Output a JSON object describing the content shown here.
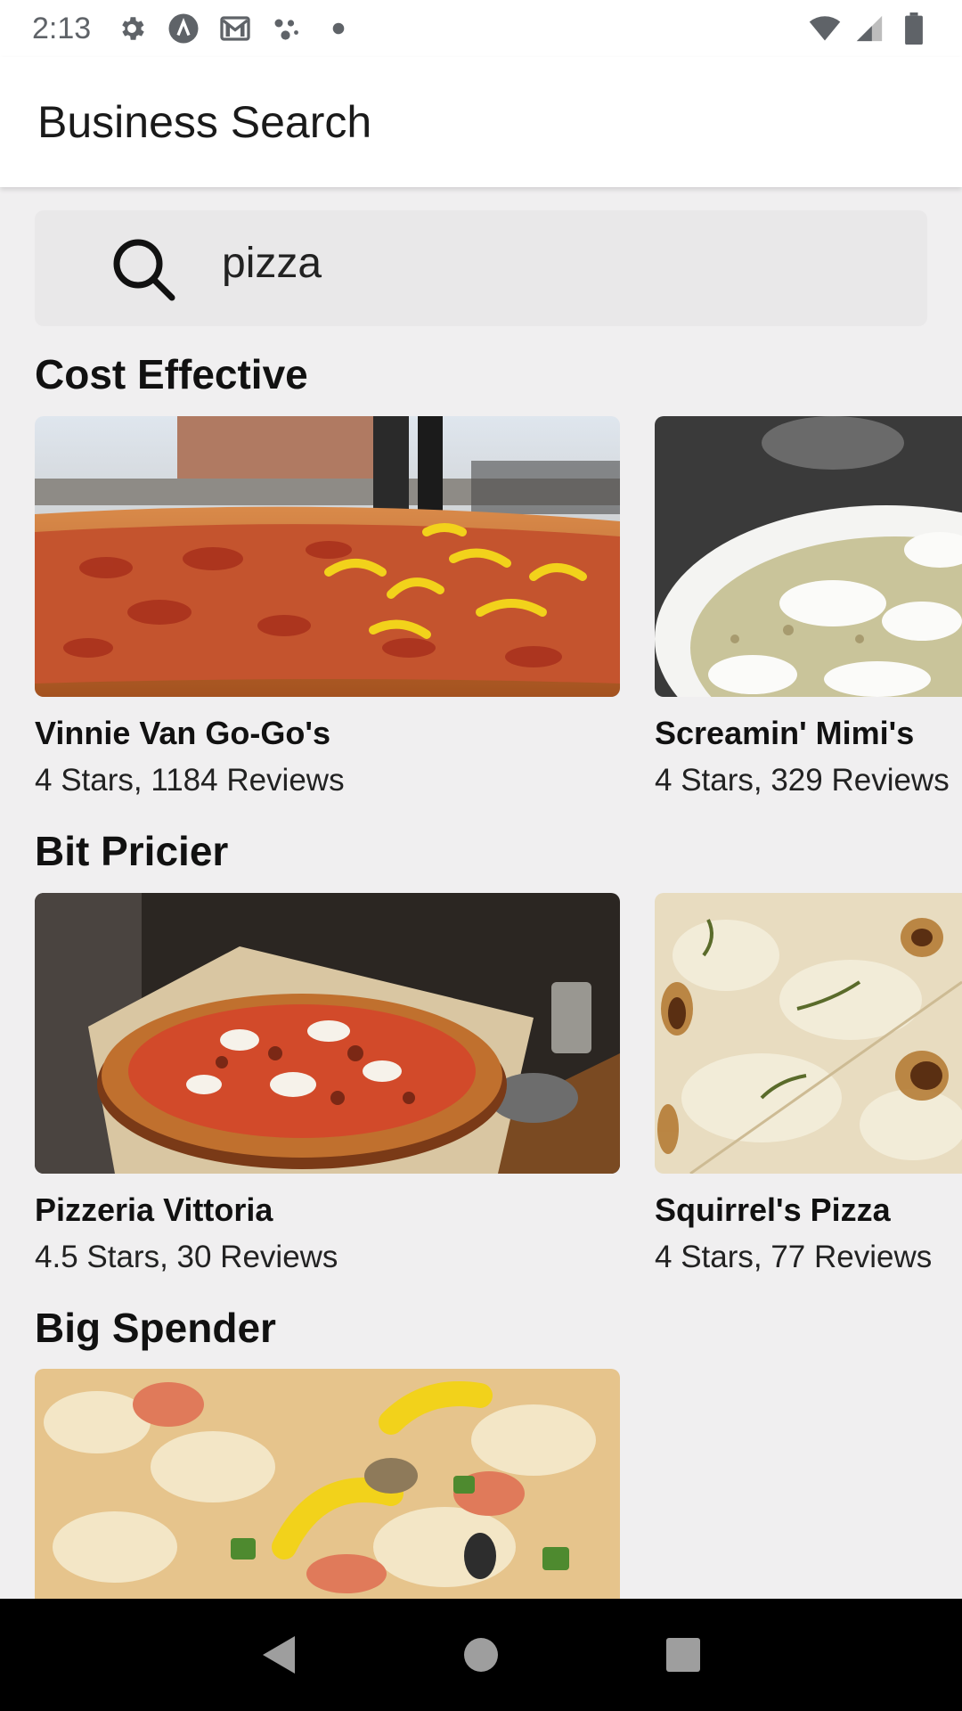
{
  "status_bar": {
    "time": "2:13",
    "icons": [
      "settings-icon",
      "app-a-icon",
      "gmail-icon",
      "assistant-icon",
      "dot-icon"
    ],
    "right_icons": [
      "wifi-icon",
      "signal-icon",
      "battery-icon"
    ]
  },
  "app_bar": {
    "title": "Business Search"
  },
  "search": {
    "value": "pizza",
    "icon": "search-icon"
  },
  "sections": [
    {
      "title": "Cost Effective",
      "items": [
        {
          "name": "Vinnie Van Go-Go's",
          "meta": "4 Stars, 1184 Reviews"
        },
        {
          "name": "Screamin' Mimi's",
          "meta": "4 Stars, 329 Reviews"
        }
      ]
    },
    {
      "title": "Bit Pricier",
      "items": [
        {
          "name": "Pizzeria Vittoria",
          "meta": "4.5 Stars, 30 Reviews"
        },
        {
          "name": "Squirrel's Pizza",
          "meta": "4 Stars, 77 Reviews"
        }
      ]
    },
    {
      "title": "Big Spender",
      "items": []
    }
  ],
  "nav_bar": {
    "buttons": [
      "back-icon",
      "home-icon",
      "recents-icon"
    ]
  },
  "colors": {
    "background": "#f0eff0",
    "app_bar": "#ffffff",
    "search_bg": "#e9e8e9",
    "nav_bar": "#000000"
  }
}
